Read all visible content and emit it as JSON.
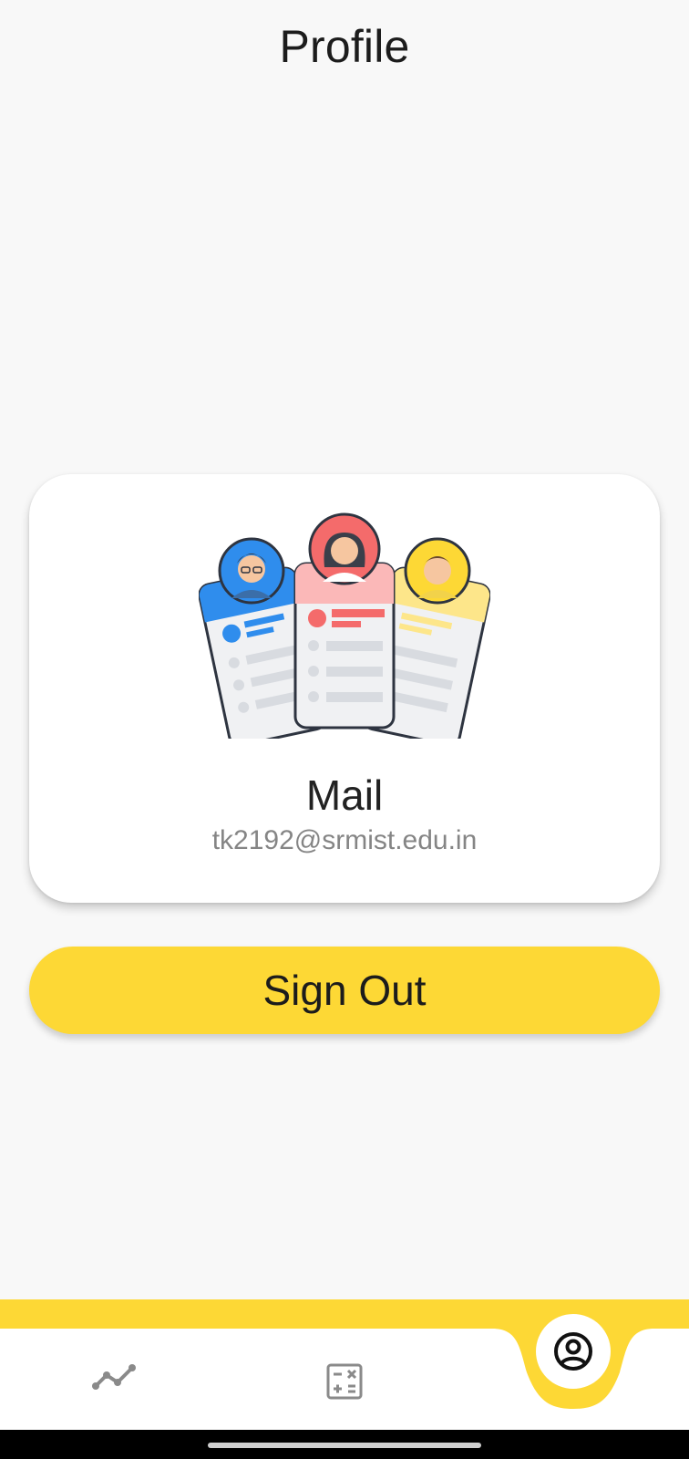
{
  "header": {
    "title": "Profile"
  },
  "profile_card": {
    "illustration_icon": "user-profile-cards-illustration",
    "label": "Mail",
    "email": "tk2192@srmist.edu.in"
  },
  "actions": {
    "sign_out_label": "Sign Out"
  },
  "bottom_nav": {
    "items": [
      {
        "icon": "trend-line-icon",
        "active": false
      },
      {
        "icon": "calculator-icon",
        "active": false
      },
      {
        "icon": "account-circle-icon",
        "active": true
      }
    ]
  },
  "colors": {
    "accent": "#fdd835",
    "background": "#f8f8f8",
    "card": "#ffffff",
    "text": "#1c1c1c",
    "muted_text": "#858585",
    "nav_icon_inactive": "#8a8a8a"
  }
}
